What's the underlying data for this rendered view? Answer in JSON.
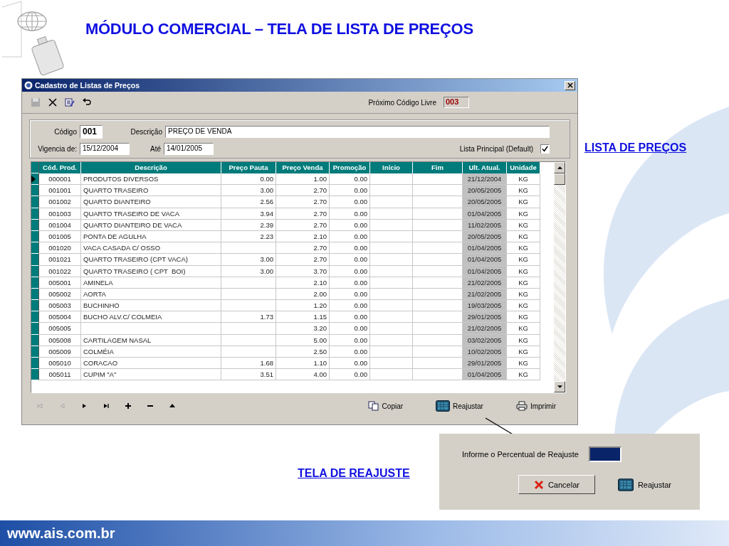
{
  "slide_title": "MÓDULO COMERCIAL – TELA DE LISTA DE PREÇOS",
  "window": {
    "title": "Cadastro de Listas de Preços",
    "next_code_label": "Próximo Código Livre",
    "next_code": "003",
    "codigo_label": "Código",
    "codigo": "001",
    "descricao_label": "Descrição",
    "descricao": "PREÇO DE VENDA",
    "vigencia_label": "Vigencia de:",
    "vigencia": "15/12/2004",
    "ate_label": "Até",
    "ate": "14/01/2005",
    "principal_label": "Lista Principal (Default)",
    "principal_checked": true
  },
  "table": {
    "columns": [
      "Cód. Prod.",
      "Descrição",
      "Preço Pauta",
      "Preço Venda",
      "Promoção",
      "Início",
      "Fim",
      "Ult. Atual.",
      "Unidade"
    ],
    "rows": [
      {
        "selected": true,
        "cells": [
          "000001",
          "PRODUTOS DIVERSOS",
          "0.00",
          "1.00",
          "0.00",
          "",
          "",
          "21/12/2004",
          "KG"
        ]
      },
      {
        "selected": false,
        "cells": [
          "001001",
          "QUARTO TRASEIRO",
          "3.00",
          "2.70",
          "0.00",
          "",
          "",
          "20/05/2005",
          "KG"
        ]
      },
      {
        "selected": false,
        "cells": [
          "001002",
          "QUARTO DIANTEIRO",
          "2.56",
          "2.70",
          "0.00",
          "",
          "",
          "20/05/2005",
          "KG"
        ]
      },
      {
        "selected": false,
        "cells": [
          "001003",
          "QUARTO TRASEIRO DE VACA",
          "3.94",
          "2.70",
          "0.00",
          "",
          "",
          "01/04/2005",
          "KG"
        ]
      },
      {
        "selected": false,
        "cells": [
          "001004",
          "QUARTO DIANTEIRO DE VACA",
          "2.39",
          "2.70",
          "0.00",
          "",
          "",
          "11/02/2005",
          "KG"
        ]
      },
      {
        "selected": false,
        "cells": [
          "001005",
          "PONTA DE AGULHA",
          "2.23",
          "2.10",
          "0.00",
          "",
          "",
          "20/05/2005",
          "KG"
        ]
      },
      {
        "selected": false,
        "cells": [
          "001020",
          "VACA CASADA C/ OSSO",
          "",
          "2.70",
          "0.00",
          "",
          "",
          "01/04/2005",
          "KG"
        ]
      },
      {
        "selected": false,
        "cells": [
          "001021",
          "QUARTO TRASEIRO (CPT VACA)",
          "3.00",
          "2.70",
          "0.00",
          "",
          "",
          "01/04/2005",
          "KG"
        ]
      },
      {
        "selected": false,
        "cells": [
          "001022",
          "QUARTO TRASEIRO ( CPT  BOI)",
          "3.00",
          "3.70",
          "0.00",
          "",
          "",
          "01/04/2005",
          "KG"
        ]
      },
      {
        "selected": false,
        "cells": [
          "005001",
          "AMINELA",
          "",
          "2.10",
          "0.00",
          "",
          "",
          "21/02/2005",
          "KG"
        ]
      },
      {
        "selected": false,
        "cells": [
          "005002",
          "AORTA",
          "",
          "2.00",
          "0.00",
          "",
          "",
          "21/02/2005",
          "KG"
        ]
      },
      {
        "selected": false,
        "cells": [
          "005003",
          "BUCHINHO",
          "",
          "1.20",
          "0.00",
          "",
          "",
          "19/03/2005",
          "KG"
        ]
      },
      {
        "selected": false,
        "cells": [
          "005004",
          "BUCHO ALV.C/ COLMEIA",
          "1.73",
          "1.15",
          "0.00",
          "",
          "",
          "29/01/2005",
          "KG"
        ]
      },
      {
        "selected": false,
        "cells": [
          "005005",
          "",
          "",
          "3.20",
          "0.00",
          "",
          "",
          "21/02/2005",
          "KG"
        ]
      },
      {
        "selected": false,
        "cells": [
          "005008",
          "CARTILAGEM NASAL",
          "",
          "5.00",
          "0.00",
          "",
          "",
          "03/02/2005",
          "KG"
        ]
      },
      {
        "selected": false,
        "cells": [
          "005009",
          "COLMÉIA",
          "",
          "2.50",
          "0.00",
          "",
          "",
          "10/02/2005",
          "KG"
        ]
      },
      {
        "selected": false,
        "cells": [
          "005010",
          "CORACAO",
          "1.68",
          "1.10",
          "0.00",
          "",
          "",
          "29/01/2005",
          "KG"
        ]
      },
      {
        "selected": false,
        "cells": [
          "005011",
          "CUPIM \"A\"",
          "3.51",
          "4.00",
          "0.00",
          "",
          "",
          "01/04/2005",
          "KG"
        ]
      }
    ]
  },
  "actions": [
    "Copiar",
    "Reajustar",
    "Imprimir"
  ],
  "lista_label": "LISTA DE PREÇOS",
  "reajuste_label": "TELA DE REAJUSTE",
  "dialog": {
    "prompt": "Informe o Percentual de Reajuste",
    "buttons": [
      "Cancelar",
      "Reajustar"
    ]
  },
  "footer": "www.ais.com.br"
}
